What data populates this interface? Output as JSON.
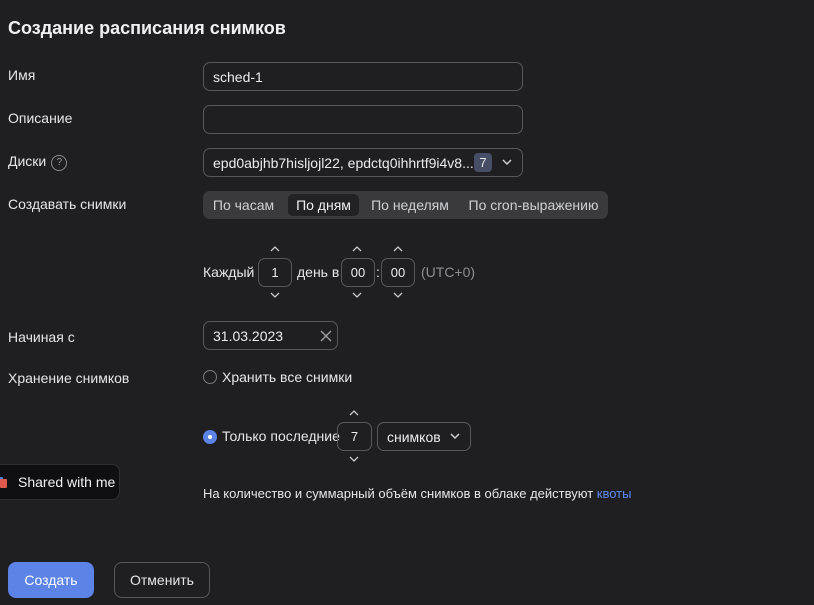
{
  "page": {
    "title": "Создание расписания снимков"
  },
  "form": {
    "name": {
      "label": "Имя",
      "value": "sched-1"
    },
    "description": {
      "label": "Описание",
      "value": ""
    },
    "disks": {
      "label": "Диски",
      "help": "?",
      "value": "epd0abjhb7hisljojl22, epdctq0ihhrtf9i4v8...",
      "count": "7"
    },
    "create_snapshots": {
      "label": "Создавать снимки",
      "options": [
        "По часам",
        "По дням",
        "По неделям",
        "По cron-выражению"
      ],
      "selected": "По дням"
    },
    "schedule": {
      "every_label": "Каждый",
      "every_value": "1",
      "day_label": "день в",
      "hour": "00",
      "separator": ":",
      "minute": "00",
      "timezone": "(UTC+0)"
    },
    "start_date": {
      "label": "Начиная с",
      "value": "31.03.2023"
    },
    "retention": {
      "label": "Хранение снимков",
      "keep_all_label": "Хранить все снимки",
      "keep_last_label": "Только последние",
      "keep_last_count": "7",
      "unit": "снимков",
      "selected": "keep_last"
    },
    "quota_note": {
      "text": "На количество и суммарный объём снимков в облаке действуют",
      "link": "квоты"
    }
  },
  "buttons": {
    "create": "Создать",
    "cancel": "Отменить"
  },
  "toast": {
    "text": "Shared with me"
  },
  "colors": {
    "background": "#1f1f21",
    "accent": "#5b84e6",
    "link": "#5e8bf0",
    "badge": "#464e66"
  }
}
